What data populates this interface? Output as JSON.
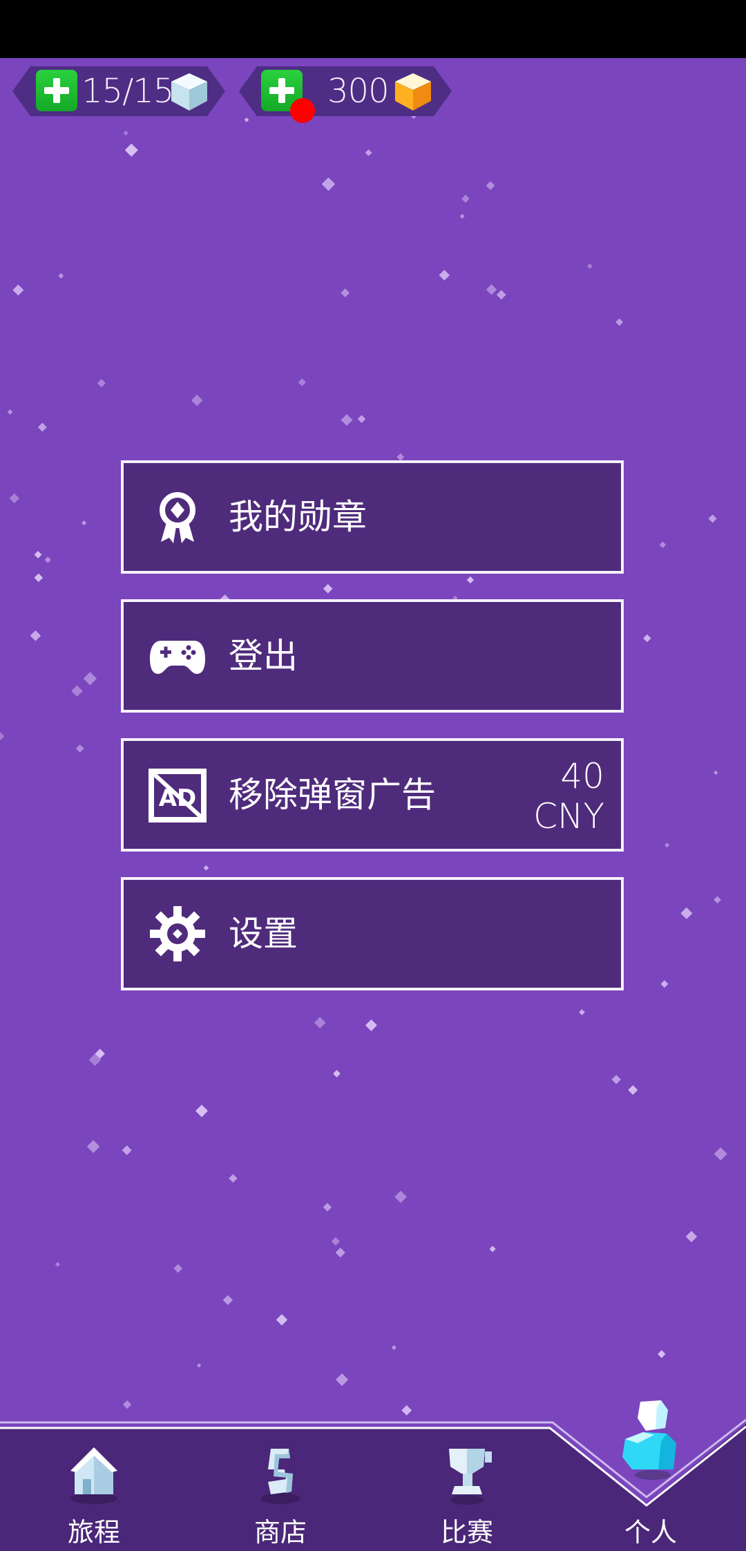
{
  "currencies": {
    "lives": {
      "value": "15/15",
      "icon": "ice-cube-icon"
    },
    "gems": {
      "value": "300",
      "icon": "gold-cube-icon",
      "has_notification": true
    }
  },
  "menu": [
    {
      "id": "badges",
      "label": "我的勋章",
      "icon": "medal-icon"
    },
    {
      "id": "logout",
      "label": "登出",
      "icon": "gamepad-icon"
    },
    {
      "id": "remove-ads",
      "label": "移除弹窗广告",
      "icon": "no-ads-icon",
      "price_amount": "40",
      "price_currency": "CNY"
    },
    {
      "id": "settings",
      "label": "设置",
      "icon": "gear-icon"
    }
  ],
  "bottom_nav": [
    {
      "id": "journey",
      "label": "旅程",
      "icon": "house-icon"
    },
    {
      "id": "shop",
      "label": "商店",
      "icon": "shop-icon"
    },
    {
      "id": "match",
      "label": "比赛",
      "icon": "trophy-icon"
    },
    {
      "id": "profile",
      "label": "个人",
      "icon": "person-icon",
      "active": true
    }
  ],
  "colors": {
    "background": "#7a45bd",
    "panel": "#4f2b7c",
    "nav_bar": "#4a2778",
    "plus_button": "#1fbf33",
    "notification": "#ff0000",
    "active_icon": "#27d3f0"
  }
}
